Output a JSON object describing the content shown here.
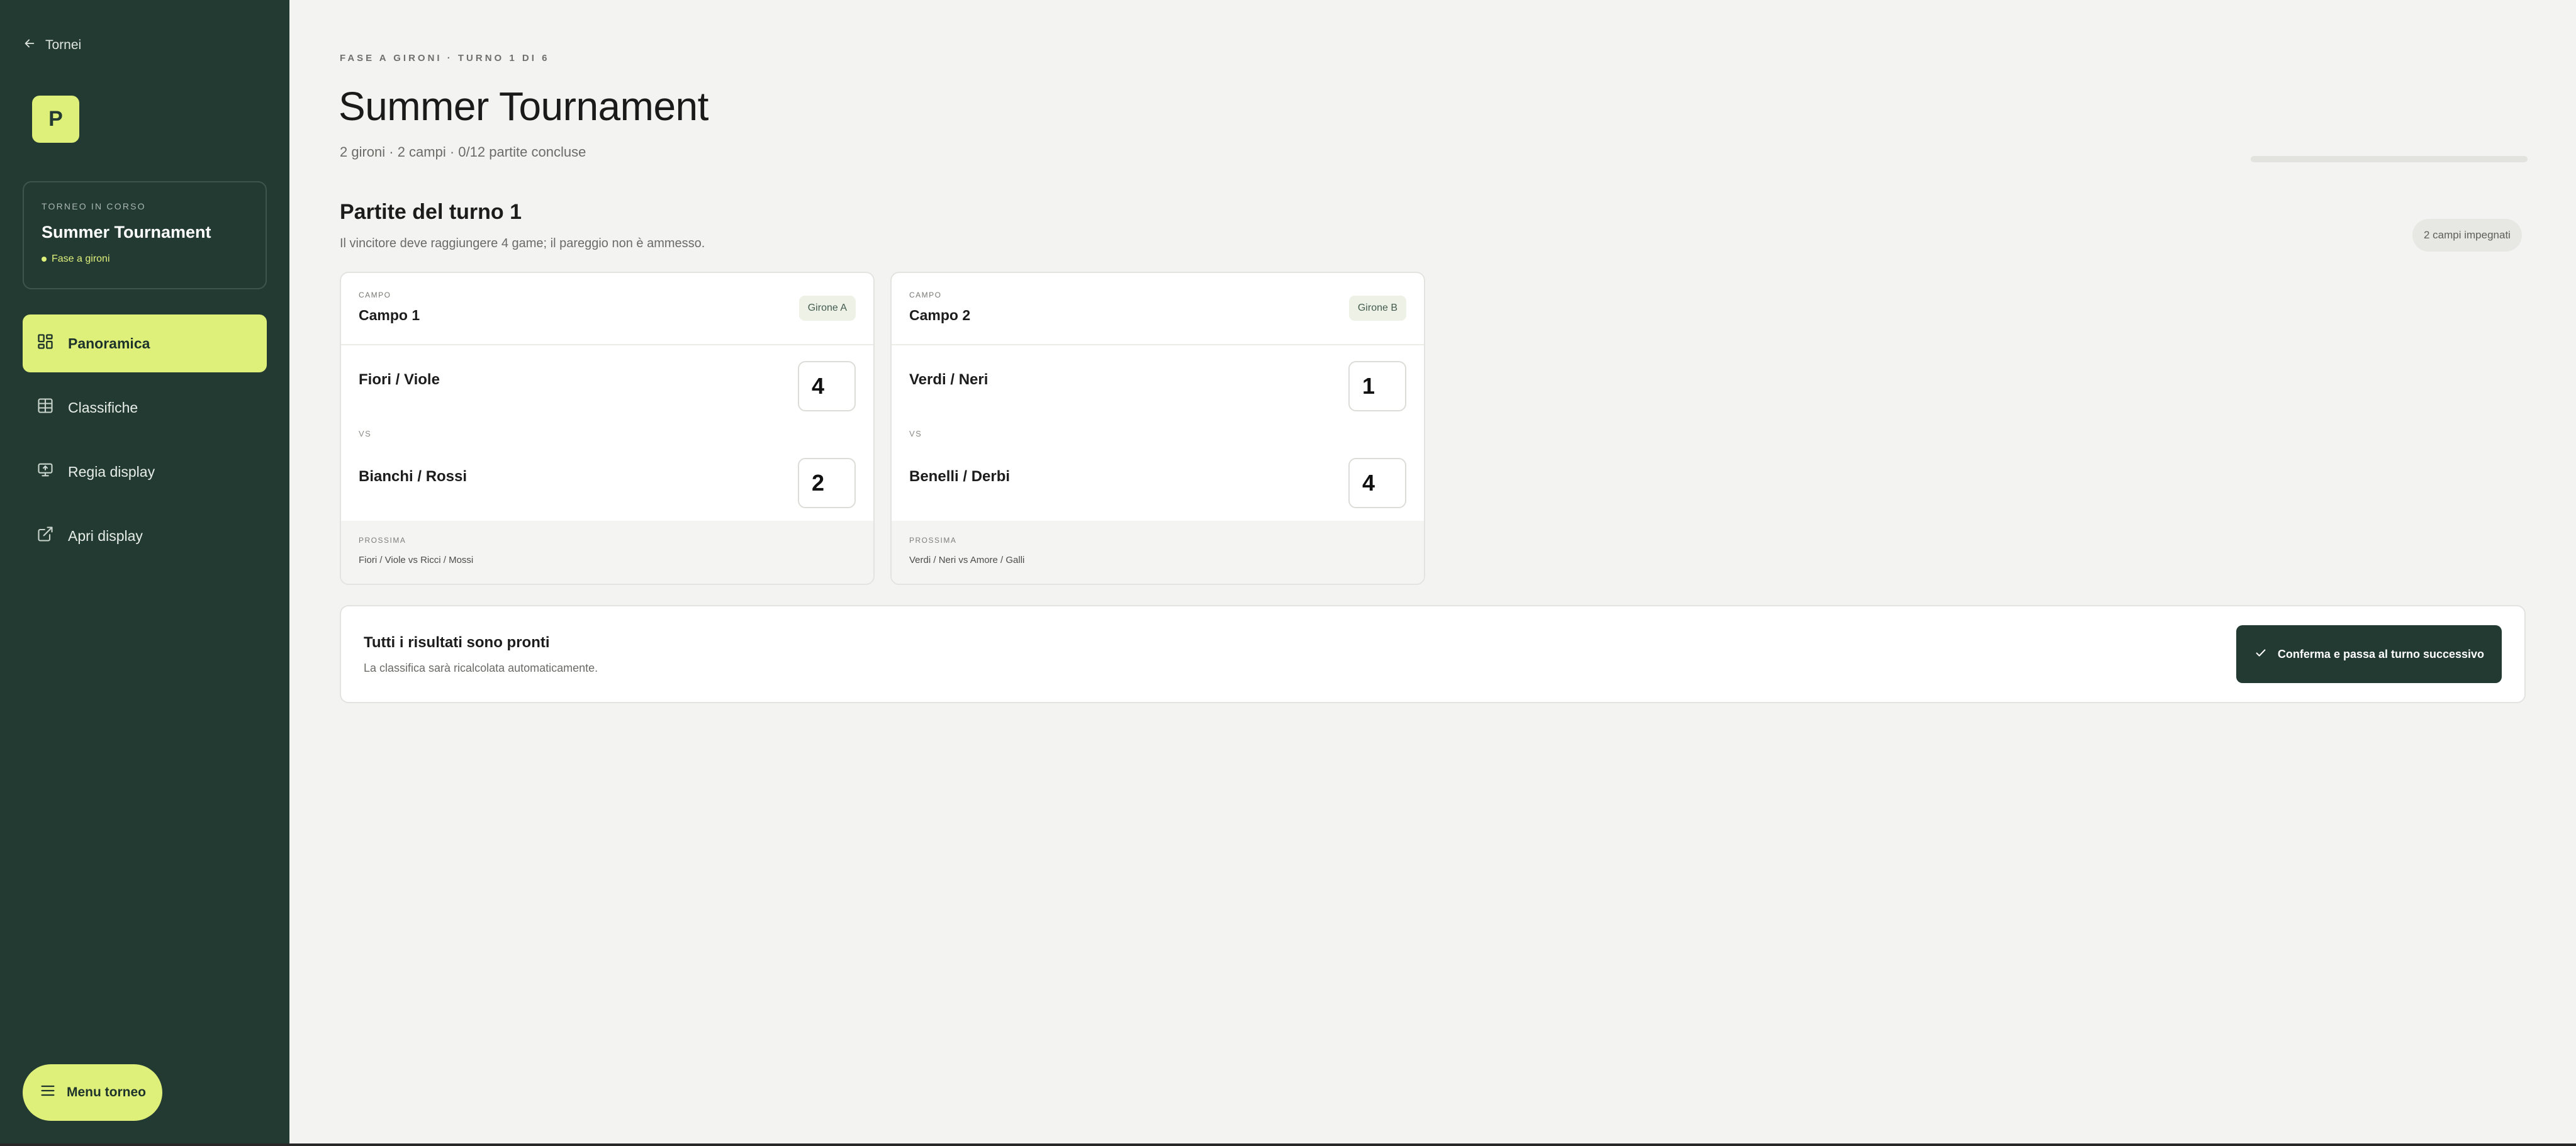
{
  "sidebar": {
    "back_label": "Tornei",
    "brand_letter": "P",
    "tour_card": {
      "kicker": "TORNEO IN CORSO",
      "name": "Summer Tournament",
      "phase": "Fase a gironi"
    },
    "nav": [
      {
        "label": "Panoramica",
        "icon": "grid-icon",
        "active": true
      },
      {
        "label": "Classifiche",
        "icon": "table-icon",
        "active": false
      },
      {
        "label": "Regia display",
        "icon": "monitor-icon",
        "active": false
      },
      {
        "label": "Apri display",
        "icon": "external-link-icon",
        "active": false
      }
    ],
    "menu_label": "Menu torneo"
  },
  "header": {
    "kicker": "FASE A GIRONI · TURNO 1 DI 6",
    "title": "Summer Tournament",
    "meta": "2 gironi · 2 campi · 0/12 partite concluse",
    "progress_fraction": 0
  },
  "round": {
    "title": "Partite del turno 1",
    "subtitle": "Il vincitore deve raggiungere 4 game; il pareggio non è ammesso.",
    "courts_badge": "2 campi impegnati"
  },
  "courts": [
    {
      "kicker": "CAMPO",
      "name": "Campo 1",
      "group": "Girone A",
      "team_a": "Fiori / Viole",
      "score_a": "4",
      "vs": "VS",
      "team_b": "Bianchi / Rossi",
      "score_b": "2",
      "next_kicker": "PROSSIMA",
      "next_match": "Fiori / Viole vs Ricci / Mossi"
    },
    {
      "kicker": "CAMPO",
      "name": "Campo 2",
      "group": "Girone B",
      "team_a": "Verdi / Neri",
      "score_a": "1",
      "vs": "VS",
      "team_b": "Benelli / Derbi",
      "score_b": "4",
      "next_kicker": "PROSSIMA",
      "next_match": "Verdi / Neri vs Amore / Galli"
    }
  ],
  "ready": {
    "title": "Tutti i risultati sono pronti",
    "subtitle": "La classifica sarà ricalcolata automaticamente.",
    "confirm_label": "Conferma e passa al turno successivo"
  },
  "colors": {
    "sidebar_bg": "#233a33",
    "accent": "#dff07a",
    "page_bg": "#f3f3f1"
  }
}
